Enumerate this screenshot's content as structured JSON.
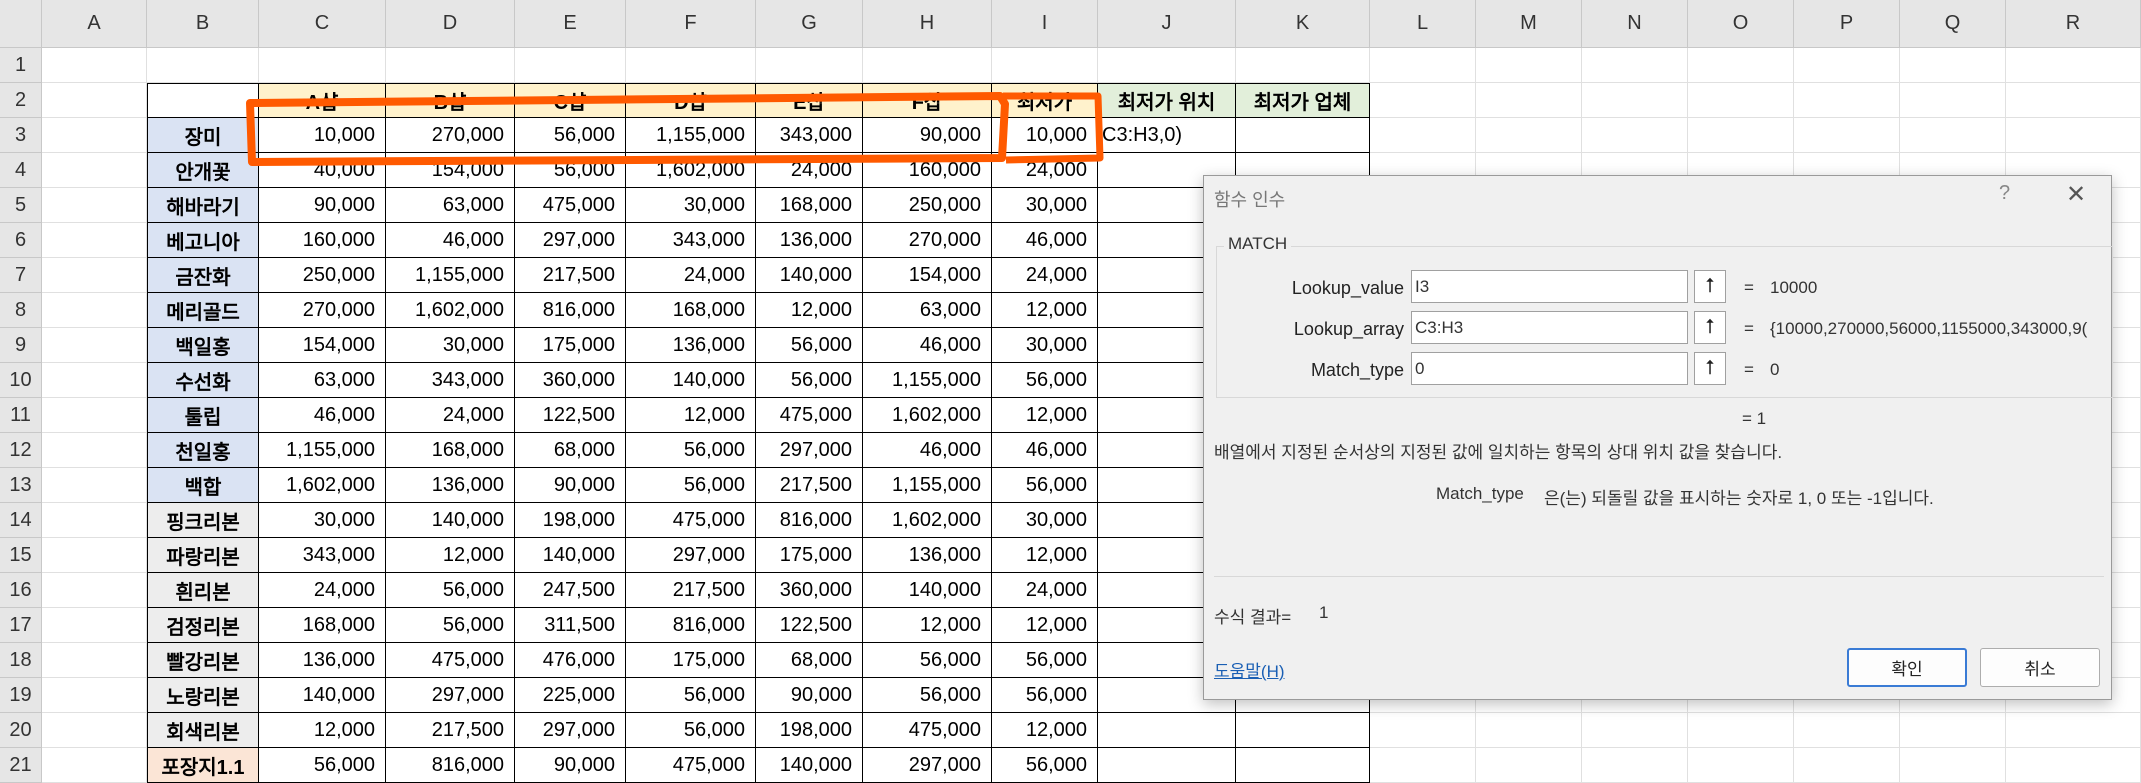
{
  "columns": [
    "A",
    "B",
    "C",
    "D",
    "E",
    "F",
    "G",
    "H",
    "I",
    "J",
    "K",
    "L",
    "M",
    "N",
    "O",
    "P",
    "Q",
    "R"
  ],
  "rows": [
    "1",
    "2",
    "3",
    "4",
    "5",
    "6",
    "7",
    "8",
    "9",
    "10",
    "11",
    "12",
    "13",
    "14",
    "15",
    "16",
    "17",
    "18",
    "19",
    "20",
    "21"
  ],
  "headers": [
    "A샵",
    "B샵",
    "C샵",
    "D샵",
    "E샵",
    "F샵",
    "최저가",
    "최저가 위치",
    "최저가 업체"
  ],
  "products": [
    "장미",
    "안개꽃",
    "해바라기",
    "베고니아",
    "금잔화",
    "메리골드",
    "백일홍",
    "수선화",
    "툴립",
    "천일홍",
    "백합",
    "핑크리본",
    "파랑리본",
    "흰리본",
    "검정리본",
    "빨강리본",
    "노랑리본",
    "회색리본",
    "포장지1.1"
  ],
  "prices": [
    [
      "10,000",
      "270,000",
      "56,000",
      "1,155,000",
      "343,000",
      "90,000",
      "10,000"
    ],
    [
      "40,000",
      "154,000",
      "56,000",
      "1,602,000",
      "24,000",
      "160,000",
      "24,000"
    ],
    [
      "90,000",
      "63,000",
      "475,000",
      "30,000",
      "168,000",
      "250,000",
      "30,000"
    ],
    [
      "160,000",
      "46,000",
      "297,000",
      "343,000",
      "136,000",
      "270,000",
      "46,000"
    ],
    [
      "250,000",
      "1,155,000",
      "217,500",
      "24,000",
      "140,000",
      "154,000",
      "24,000"
    ],
    [
      "270,000",
      "1,602,000",
      "816,000",
      "168,000",
      "12,000",
      "63,000",
      "12,000"
    ],
    [
      "154,000",
      "30,000",
      "175,000",
      "136,000",
      "56,000",
      "46,000",
      "30,000"
    ],
    [
      "63,000",
      "343,000",
      "360,000",
      "140,000",
      "56,000",
      "1,155,000",
      "56,000"
    ],
    [
      "46,000",
      "24,000",
      "122,500",
      "12,000",
      "475,000",
      "1,602,000",
      "12,000"
    ],
    [
      "1,155,000",
      "168,000",
      "68,000",
      "56,000",
      "297,000",
      "46,000",
      "46,000"
    ],
    [
      "1,602,000",
      "136,000",
      "90,000",
      "56,000",
      "217,500",
      "1,155,000",
      "56,000"
    ],
    [
      "30,000",
      "140,000",
      "198,000",
      "475,000",
      "816,000",
      "1,602,000",
      "30,000"
    ],
    [
      "343,000",
      "12,000",
      "140,000",
      "297,000",
      "175,000",
      "136,000",
      "12,000"
    ],
    [
      "24,000",
      "56,000",
      "247,500",
      "217,500",
      "360,000",
      "140,000",
      "24,000"
    ],
    [
      "168,000",
      "56,000",
      "311,500",
      "816,000",
      "122,500",
      "12,000",
      "12,000"
    ],
    [
      "136,000",
      "475,000",
      "476,000",
      "175,000",
      "68,000",
      "56,000",
      "56,000"
    ],
    [
      "140,000",
      "297,000",
      "225,000",
      "56,000",
      "90,000",
      "56,000",
      "56,000"
    ],
    [
      "12,000",
      "217,500",
      "297,000",
      "56,000",
      "198,000",
      "475,000",
      "12,000"
    ],
    [
      "56,000",
      "816,000",
      "90,000",
      "475,000",
      "140,000",
      "297,000",
      "56,000"
    ]
  ],
  "j3_text": "C3:H3,0)",
  "colors": {
    "header_yellow": "#fff2cc",
    "header_green": "#e2efda",
    "product_blue": "#dae3f3",
    "product_gray": "#ededed",
    "product_orange": "#fbe5d6",
    "annotation_red": "#ff5a00"
  },
  "dialog": {
    "title": "함수 인수",
    "help_glyph": "?",
    "close_glyph": "✕",
    "function_name": "MATCH",
    "args": [
      {
        "label": "Lookup_value",
        "value": "I3",
        "result": "10000"
      },
      {
        "label": "Lookup_array",
        "value": "C3:H3",
        "result": "{10000,270000,56000,1155000,343000,9("
      },
      {
        "label": "Match_type",
        "value": "0",
        "result": "0"
      }
    ],
    "ref_icon": "collapse-dialog-icon",
    "eq": "=",
    "overall_result": "= 1",
    "description": "배열에서 지정된 순서상의 지정된 값에 일치하는 항목의 상대 위치 값을 찾습니다.",
    "arg_name": "Match_type",
    "arg_description": "은(는) 되돌릴 값을 표시하는 숫자로 1, 0 또는 -1입니다.",
    "formula_result_label": "수식 결과=",
    "formula_result_value": "1",
    "help_link": "도움말(H)",
    "ok": "확인",
    "cancel": "취소"
  }
}
